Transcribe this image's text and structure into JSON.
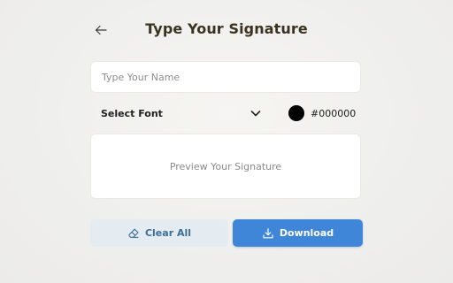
{
  "header": {
    "back_icon": "arrow-left-icon",
    "title": "Type Your Signature"
  },
  "name_field": {
    "placeholder": "Type Your Name",
    "value": ""
  },
  "font_select": {
    "label": "Select Font",
    "icon": "chevron-down-icon"
  },
  "color_picker": {
    "swatch_color": "#000000",
    "value": "#000000"
  },
  "preview": {
    "placeholder": "Preview Your Signature"
  },
  "actions": {
    "clear_label": "Clear All",
    "clear_icon": "eraser-icon",
    "download_label": "Download",
    "download_icon": "download-icon"
  },
  "colors": {
    "primary": "#3f86d8",
    "secondary_bg": "#e4ecf2",
    "secondary_text": "#3d6e98",
    "title": "#3a3322"
  }
}
